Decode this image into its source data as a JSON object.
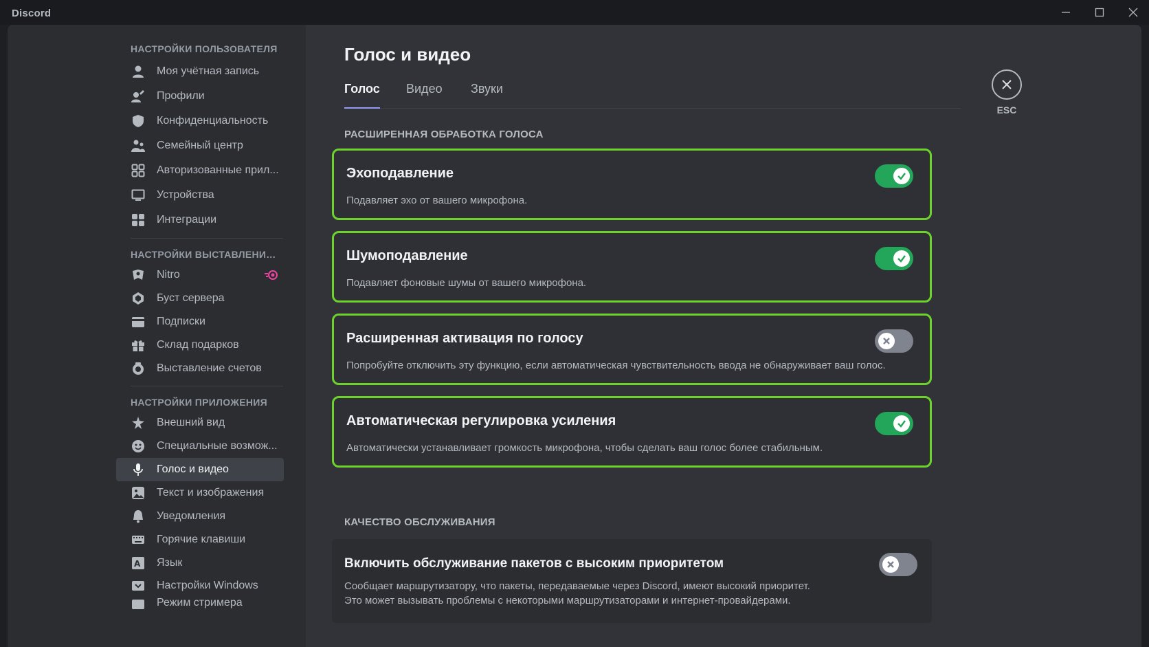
{
  "app": {
    "name": "Discord"
  },
  "sidebar": {
    "groups": [
      {
        "header": "Настройки пользователя",
        "items": [
          {
            "label": "Моя учётная запись",
            "icon": "user-icon"
          },
          {
            "label": "Профили",
            "icon": "pencil-user-icon"
          },
          {
            "label": "Конфиденциальность",
            "icon": "shield-icon"
          },
          {
            "label": "Семейный центр",
            "icon": "family-icon"
          },
          {
            "label": "Авторизованные прил...",
            "icon": "apps-grid-icon"
          },
          {
            "label": "Устройства",
            "icon": "monitor-icon"
          },
          {
            "label": "Интеграции",
            "icon": "integrations-icon"
          }
        ]
      },
      {
        "header": "Настройки выставления...",
        "items": [
          {
            "label": "Nitro",
            "icon": "nitro-icon",
            "badge_icon": "nitro-badge-icon"
          },
          {
            "label": "Буст сервера",
            "icon": "boost-icon"
          },
          {
            "label": "Подписки",
            "icon": "subscriptions-icon"
          },
          {
            "label": "Склад подарков",
            "icon": "gift-icon"
          },
          {
            "label": "Выставление счетов",
            "icon": "billing-icon"
          }
        ]
      },
      {
        "header": "Настройки приложения",
        "items": [
          {
            "label": "Внешний вид",
            "icon": "palette-icon"
          },
          {
            "label": "Специальные возмож...",
            "icon": "accessibility-icon"
          },
          {
            "label": "Голос и видео",
            "icon": "microphone-icon",
            "active": true
          },
          {
            "label": "Текст и изображения",
            "icon": "image-icon"
          },
          {
            "label": "Уведомления",
            "icon": "bell-icon"
          },
          {
            "label": "Горячие клавиши",
            "icon": "keyboard-icon"
          },
          {
            "label": "Язык",
            "icon": "language-icon"
          },
          {
            "label": "Настройки Windows",
            "icon": "windows-icon"
          },
          {
            "label": "Режим стримера",
            "icon": "streamer-icon"
          }
        ]
      }
    ]
  },
  "main": {
    "title": "Голос и видео",
    "tabs": [
      {
        "label": "Голос",
        "active": true
      },
      {
        "label": "Видео"
      },
      {
        "label": "Звуки"
      }
    ],
    "section_voice": "Расширенная обработка голоса",
    "settings": [
      {
        "title": "Эхоподавление",
        "desc": "Подавляет эхо от вашего микрофона.",
        "enabled": true
      },
      {
        "title": "Шумоподавление",
        "desc": "Подавляет фоновые шумы от вашего микрофона.",
        "enabled": true
      },
      {
        "title": "Расширенная активация по голосу",
        "desc": "Попробуйте отключить эту функцию, если автоматическая чувствительность ввода не обнаруживает ваш голос.",
        "enabled": false
      },
      {
        "title": "Автоматическая регулировка усиления",
        "desc": "Автоматически устанавливает громкость микрофона, чтобы сделать ваш голос более стабильным.",
        "enabled": true
      }
    ],
    "section_qos": "Качество обслуживания",
    "qos": {
      "title": "Включить обслуживание пакетов с высоким приоритетом",
      "desc_line1": "Сообщает маршрутизатору, что пакеты, передаваемые через Discord, имеют высокий приоритет.",
      "desc_line2": "Это может вызывать проблемы с некоторыми маршрутизаторами и интернет-провайдерами.",
      "enabled": false
    }
  },
  "close": {
    "label": "ESC",
    "icon": "close-icon"
  },
  "colors": {
    "highlight": "#6ed22c",
    "toggle_on": "#23a55a",
    "toggle_off": "#80848e",
    "tab_underline": "#949cf7",
    "nitro_pink": "#eb459f"
  }
}
